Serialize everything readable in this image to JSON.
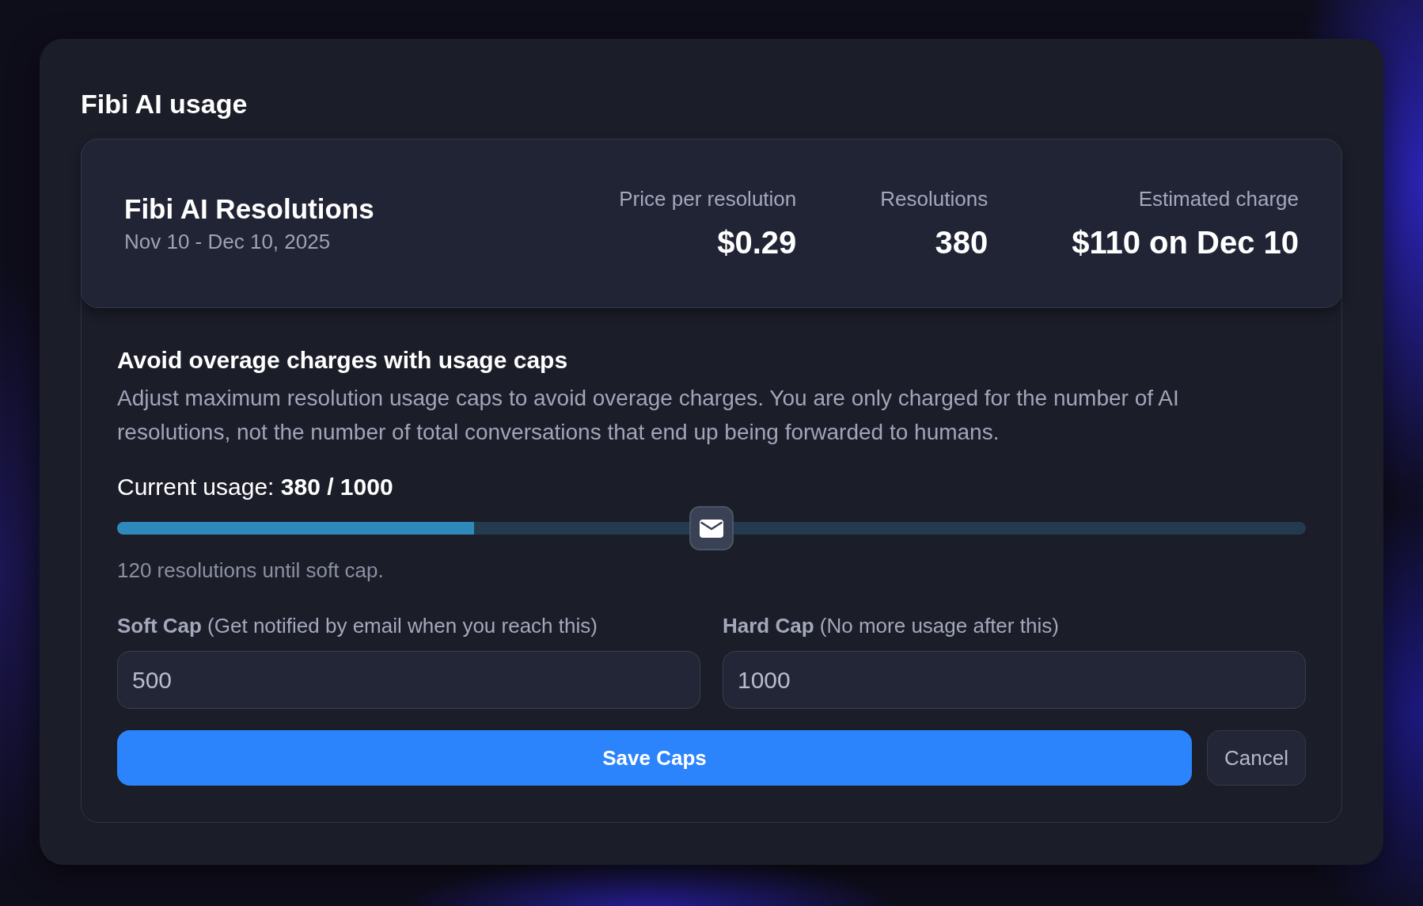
{
  "dialog": {
    "title": "Fibi AI usage"
  },
  "summary": {
    "title": "Fibi AI Resolutions",
    "period": "Nov 10 - Dec 10, 2025",
    "stats": [
      {
        "label": "Price per resolution",
        "value": "$0.29"
      },
      {
        "label": "Resolutions",
        "value": "380"
      },
      {
        "label": "Estimated charge",
        "value": "$110 on Dec 10"
      }
    ]
  },
  "caps": {
    "heading": "Avoid overage charges with usage caps",
    "description": "Adjust maximum resolution usage caps to avoid overage charges. You are only charged for the number of AI resolutions, not the number of total conversations that end up being forwarded to humans.",
    "usage_label": "Current usage: **380 / 1000**",
    "usage_bar": {
      "level": 0.3,
      "soft_cap_marker": {
        "level": 0.5
      }
    },
    "hint": "120 resolutions until soft cap.",
    "fields": [
      {
        "label": "**Soft Cap** (Get notified by email when you reach this)",
        "value": "500"
      },
      {
        "label": "**Hard Cap** (No more usage after this)",
        "value": "1000"
      }
    ],
    "buttons": [
      {
        "kind": "primary",
        "label": "Save Caps"
      },
      {
        "kind": "secondary",
        "label": "Cancel"
      }
    ]
  }
}
